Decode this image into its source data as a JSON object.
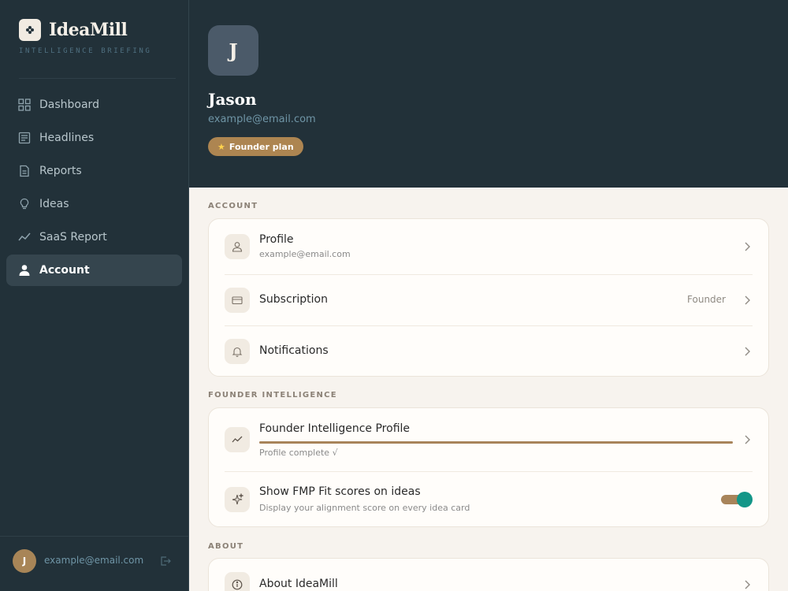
{
  "brand": {
    "name": "IdeaMill",
    "tagline": "INTELLIGENCE BRIEFING",
    "logo_icon": "flower-icon"
  },
  "sidebar": {
    "items": [
      {
        "label": "Dashboard",
        "icon": "grid-icon",
        "active": false
      },
      {
        "label": "Headlines",
        "icon": "newspaper-icon",
        "active": false
      },
      {
        "label": "Reports",
        "icon": "document-icon",
        "active": false
      },
      {
        "label": "Ideas",
        "icon": "lightbulb-icon",
        "active": false
      },
      {
        "label": "SaaS Report",
        "icon": "trend-icon",
        "active": false
      },
      {
        "label": "Account",
        "icon": "user-icon",
        "active": true
      }
    ],
    "footer": {
      "avatar_initial": "J",
      "email": "example@email.com",
      "logout_icon": "logout-icon"
    }
  },
  "header": {
    "avatar_initial": "J",
    "name": "Jason",
    "email": "example@email.com",
    "plan_badge": "Founder plan",
    "plan_icon": "star-icon"
  },
  "sections": {
    "account": {
      "title": "ACCOUNT",
      "rows": [
        {
          "title": "Profile",
          "subtitle": "example@email.com",
          "icon": "user-outline-icon"
        },
        {
          "title": "Subscription",
          "value": "Founder",
          "icon": "credit-card-icon"
        },
        {
          "title": "Notifications",
          "icon": "bell-icon"
        }
      ]
    },
    "founder": {
      "title": "FOUNDER INTELLIGENCE",
      "profile": {
        "title": "Founder Intelligence Profile",
        "subtitle": "Profile complete √",
        "progress": 1.0,
        "icon": "trend-icon"
      },
      "fmp": {
        "title": "Show FMP Fit scores on ideas",
        "subtitle": "Display your alignment score on every idea card",
        "enabled": true,
        "icon": "sparkles-icon"
      }
    },
    "about": {
      "title": "ABOUT",
      "rows": [
        {
          "title": "About IdeaMill",
          "icon": "info-icon"
        }
      ]
    }
  },
  "colors": {
    "sidebar_bg": "#223139",
    "accent": "#a8845a",
    "toggle_on": "#139688",
    "page_bg": "#f7f3ee"
  }
}
